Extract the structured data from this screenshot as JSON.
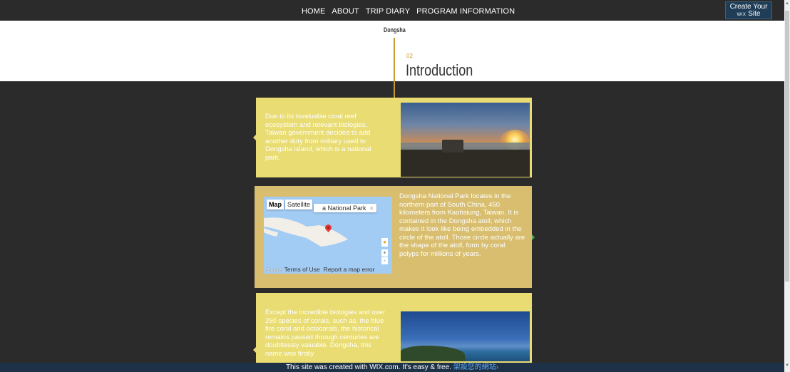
{
  "nav": {
    "items": [
      "HOME",
      "ABOUT",
      "TRIP DIARY",
      "PROGRAM INFORMATION"
    ]
  },
  "wix_badge": {
    "line1": "Create Your",
    "line2_small": "WIX",
    "line2": "Site"
  },
  "header": {
    "site_name": "Dongsha",
    "section_number": "02",
    "section_title": "Introduction"
  },
  "cards": [
    {
      "text": "Due to its invaluable coral reef ecosystem and relevant biologies, Taiwan government decided to add another duty from military used to Dongsha island, which is a national park."
    },
    {
      "text": "Dongsha National Park locates in the northern part of South China, 450 kilometers from Kaohsiung, Taiwan. It is contained in the Dongsha atoll, which makes it look like being embedded in the circle of the atoll. Those circle actually are the shape of the atoll, form by coral polyps for millions of years."
    },
    {
      "text": "Except the incredible biologies and over 250 species of corals, such as, the blue fire coral and octocorals, the historical remains passed through centuries are doubtlessly valuable. Dongsha, this name was firstly"
    }
  ],
  "map": {
    "btn_map": "Map",
    "btn_satellite": "Satellite",
    "place_label": "a National Park",
    "close": "×",
    "zoom_in": "+",
    "zoom_out": "-",
    "google_logo": "Google",
    "terms": "Terms of Use",
    "report": "Report a map error"
  },
  "banner": {
    "text": "This site was created with WIX.com. It's easy & free.",
    "cta": "架設您的網站›"
  },
  "colors": {
    "dark_bg": "#2b2b2b",
    "card_yellow": "#e9dc72",
    "card_tan": "#d8be6e",
    "accent_gold": "#c59a32",
    "banner_bg": "#1e3247"
  }
}
